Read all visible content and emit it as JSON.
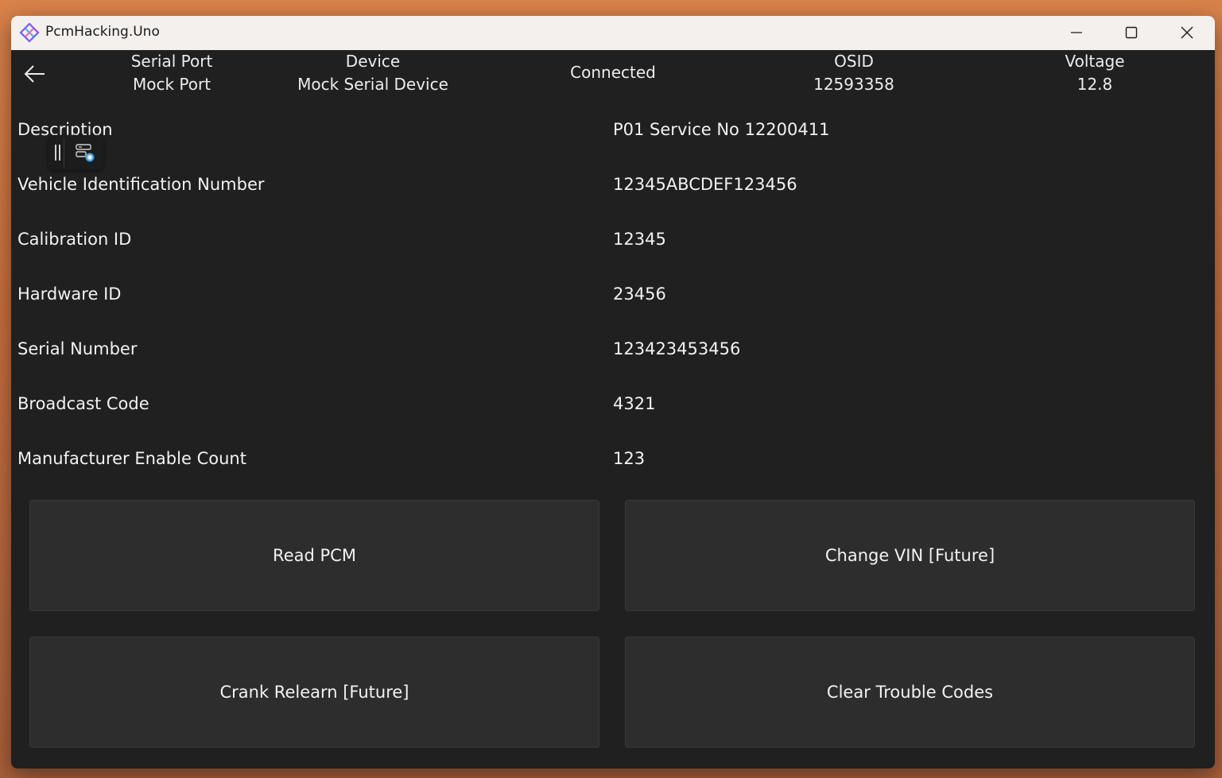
{
  "window": {
    "title": "PcmHacking.Uno",
    "controls": [
      "minimize-icon",
      "maximize-icon",
      "close-icon"
    ]
  },
  "header": {
    "back_icon": "arrow-left-icon",
    "serial_port": {
      "label": "Serial Port",
      "value": "Mock Port"
    },
    "device": {
      "label": "Device",
      "value": "Mock Serial Device"
    },
    "status": "Connected",
    "osid": {
      "label": "OSID",
      "value": "12593358"
    },
    "voltage": {
      "label": "Voltage",
      "value": "12.8"
    }
  },
  "info_rows": [
    {
      "label": "Description",
      "value": "P01 Service No 12200411"
    },
    {
      "label": "Vehicle Identification Number",
      "value": "12345ABCDEF123456"
    },
    {
      "label": "Calibration ID",
      "value": "12345"
    },
    {
      "label": "Hardware ID",
      "value": "23456"
    },
    {
      "label": "Serial Number",
      "value": "123423453456"
    },
    {
      "label": "Broadcast Code",
      "value": "4321"
    },
    {
      "label": "Manufacturer Enable Count",
      "value": "123"
    }
  ],
  "actions": [
    {
      "label": "Read PCM"
    },
    {
      "label": "Change VIN [Future]"
    },
    {
      "label": "Crank Relearn [Future]"
    },
    {
      "label": "Clear Trouble Codes"
    }
  ],
  "colors": {
    "window_bg": "#202020",
    "titlebar_bg": "#f3f0ee",
    "button_bg": "#2d2d2d",
    "text": "#f2f2f2"
  }
}
